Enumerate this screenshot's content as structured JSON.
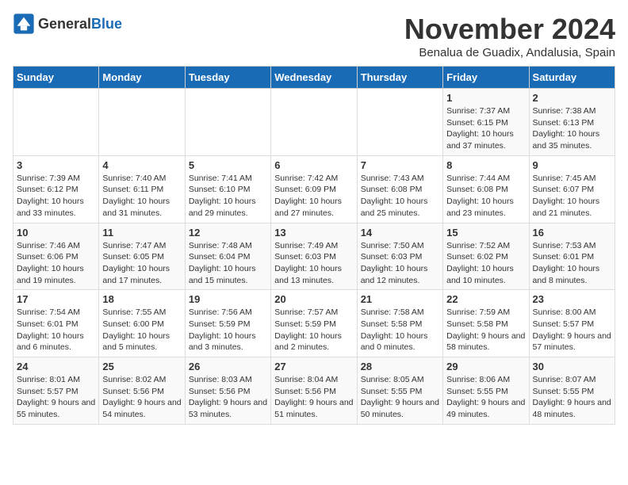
{
  "header": {
    "logo_general": "General",
    "logo_blue": "Blue",
    "month_title": "November 2024",
    "location": "Benalua de Guadix, Andalusia, Spain"
  },
  "weekdays": [
    "Sunday",
    "Monday",
    "Tuesday",
    "Wednesday",
    "Thursday",
    "Friday",
    "Saturday"
  ],
  "weeks": [
    [
      {
        "day": "",
        "info": ""
      },
      {
        "day": "",
        "info": ""
      },
      {
        "day": "",
        "info": ""
      },
      {
        "day": "",
        "info": ""
      },
      {
        "day": "",
        "info": ""
      },
      {
        "day": "1",
        "info": "Sunrise: 7:37 AM\nSunset: 6:15 PM\nDaylight: 10 hours and 37 minutes."
      },
      {
        "day": "2",
        "info": "Sunrise: 7:38 AM\nSunset: 6:13 PM\nDaylight: 10 hours and 35 minutes."
      }
    ],
    [
      {
        "day": "3",
        "info": "Sunrise: 7:39 AM\nSunset: 6:12 PM\nDaylight: 10 hours and 33 minutes."
      },
      {
        "day": "4",
        "info": "Sunrise: 7:40 AM\nSunset: 6:11 PM\nDaylight: 10 hours and 31 minutes."
      },
      {
        "day": "5",
        "info": "Sunrise: 7:41 AM\nSunset: 6:10 PM\nDaylight: 10 hours and 29 minutes."
      },
      {
        "day": "6",
        "info": "Sunrise: 7:42 AM\nSunset: 6:09 PM\nDaylight: 10 hours and 27 minutes."
      },
      {
        "day": "7",
        "info": "Sunrise: 7:43 AM\nSunset: 6:08 PM\nDaylight: 10 hours and 25 minutes."
      },
      {
        "day": "8",
        "info": "Sunrise: 7:44 AM\nSunset: 6:08 PM\nDaylight: 10 hours and 23 minutes."
      },
      {
        "day": "9",
        "info": "Sunrise: 7:45 AM\nSunset: 6:07 PM\nDaylight: 10 hours and 21 minutes."
      }
    ],
    [
      {
        "day": "10",
        "info": "Sunrise: 7:46 AM\nSunset: 6:06 PM\nDaylight: 10 hours and 19 minutes."
      },
      {
        "day": "11",
        "info": "Sunrise: 7:47 AM\nSunset: 6:05 PM\nDaylight: 10 hours and 17 minutes."
      },
      {
        "day": "12",
        "info": "Sunrise: 7:48 AM\nSunset: 6:04 PM\nDaylight: 10 hours and 15 minutes."
      },
      {
        "day": "13",
        "info": "Sunrise: 7:49 AM\nSunset: 6:03 PM\nDaylight: 10 hours and 13 minutes."
      },
      {
        "day": "14",
        "info": "Sunrise: 7:50 AM\nSunset: 6:03 PM\nDaylight: 10 hours and 12 minutes."
      },
      {
        "day": "15",
        "info": "Sunrise: 7:52 AM\nSunset: 6:02 PM\nDaylight: 10 hours and 10 minutes."
      },
      {
        "day": "16",
        "info": "Sunrise: 7:53 AM\nSunset: 6:01 PM\nDaylight: 10 hours and 8 minutes."
      }
    ],
    [
      {
        "day": "17",
        "info": "Sunrise: 7:54 AM\nSunset: 6:01 PM\nDaylight: 10 hours and 6 minutes."
      },
      {
        "day": "18",
        "info": "Sunrise: 7:55 AM\nSunset: 6:00 PM\nDaylight: 10 hours and 5 minutes."
      },
      {
        "day": "19",
        "info": "Sunrise: 7:56 AM\nSunset: 5:59 PM\nDaylight: 10 hours and 3 minutes."
      },
      {
        "day": "20",
        "info": "Sunrise: 7:57 AM\nSunset: 5:59 PM\nDaylight: 10 hours and 2 minutes."
      },
      {
        "day": "21",
        "info": "Sunrise: 7:58 AM\nSunset: 5:58 PM\nDaylight: 10 hours and 0 minutes."
      },
      {
        "day": "22",
        "info": "Sunrise: 7:59 AM\nSunset: 5:58 PM\nDaylight: 9 hours and 58 minutes."
      },
      {
        "day": "23",
        "info": "Sunrise: 8:00 AM\nSunset: 5:57 PM\nDaylight: 9 hours and 57 minutes."
      }
    ],
    [
      {
        "day": "24",
        "info": "Sunrise: 8:01 AM\nSunset: 5:57 PM\nDaylight: 9 hours and 55 minutes."
      },
      {
        "day": "25",
        "info": "Sunrise: 8:02 AM\nSunset: 5:56 PM\nDaylight: 9 hours and 54 minutes."
      },
      {
        "day": "26",
        "info": "Sunrise: 8:03 AM\nSunset: 5:56 PM\nDaylight: 9 hours and 53 minutes."
      },
      {
        "day": "27",
        "info": "Sunrise: 8:04 AM\nSunset: 5:56 PM\nDaylight: 9 hours and 51 minutes."
      },
      {
        "day": "28",
        "info": "Sunrise: 8:05 AM\nSunset: 5:55 PM\nDaylight: 9 hours and 50 minutes."
      },
      {
        "day": "29",
        "info": "Sunrise: 8:06 AM\nSunset: 5:55 PM\nDaylight: 9 hours and 49 minutes."
      },
      {
        "day": "30",
        "info": "Sunrise: 8:07 AM\nSunset: 5:55 PM\nDaylight: 9 hours and 48 minutes."
      }
    ]
  ]
}
